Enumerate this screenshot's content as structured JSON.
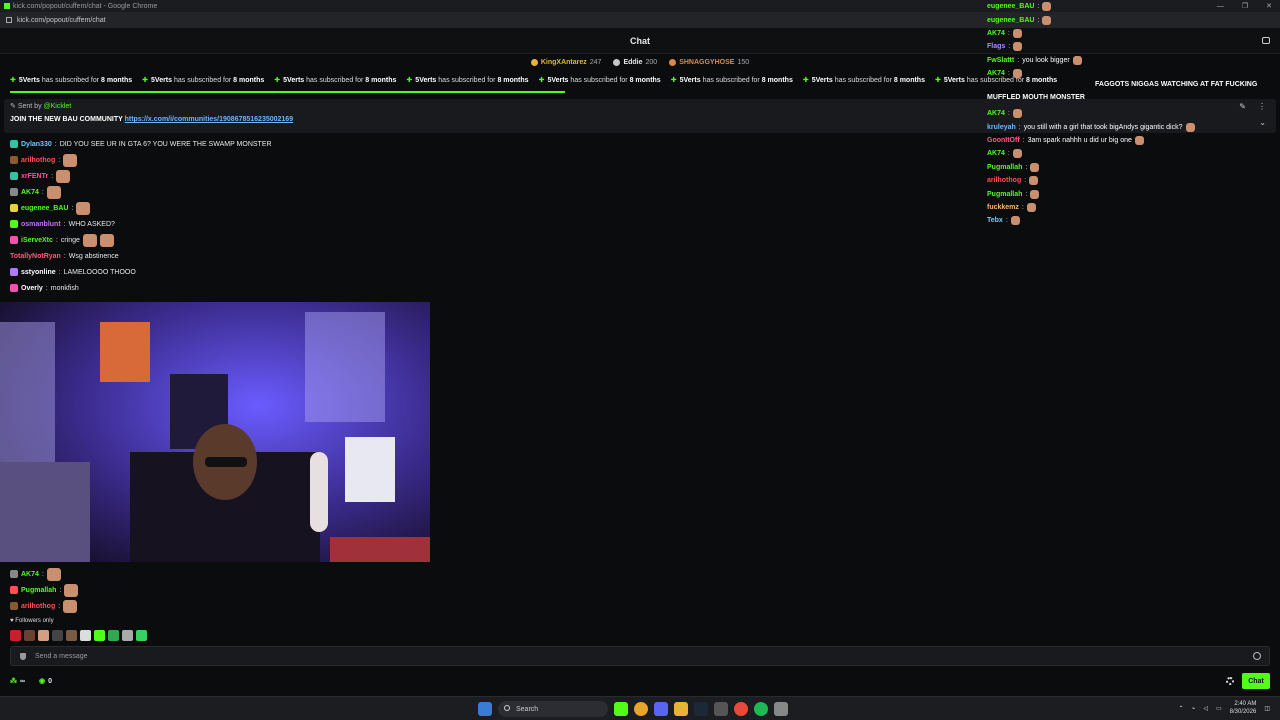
{
  "window": {
    "title": "kick.com/popout/cuffem/chat - Google Chrome",
    "url": "kick.com/popout/cuffem/chat",
    "controls": [
      "—",
      "❐",
      "✕"
    ]
  },
  "header": {
    "title": "Chat"
  },
  "gifters": [
    {
      "name": "KingXAntarez",
      "count": "247",
      "color": "#e8b339"
    },
    {
      "name": "Eddie",
      "count": "200",
      "color": "#ffffff"
    },
    {
      "name": "SHNAGGYHOSE",
      "count": "150",
      "color": "#e08a4a"
    }
  ],
  "ticker": {
    "items": [
      {
        "user": "5Verts",
        "text": "has subscribed for",
        "months": "8 months"
      },
      {
        "user": "5Verts",
        "text": "has subscribed for",
        "months": "8 months"
      },
      {
        "user": "5Verts",
        "text": "has subscribed for",
        "months": "8 months"
      },
      {
        "user": "5Verts",
        "text": "has subscribed for",
        "months": "8 months"
      },
      {
        "user": "5Verts",
        "text": "has subscribed for",
        "months": "8 months"
      },
      {
        "user": "5Verts",
        "text": "has subscribed for",
        "months": "8 months"
      },
      {
        "user": "5Verts",
        "text": "has subscribed for",
        "months": "8 months"
      },
      {
        "user": "5Verts",
        "text": "has subscribed for",
        "months": "8 months"
      }
    ]
  },
  "pinned": {
    "sent_by_label": "Sent by",
    "sender": "@Kicklet",
    "message": "JOIN THE NEW BAU COMMUNITY",
    "link": "https://x.com/i/communities/1908678516235002169"
  },
  "chat": [
    {
      "user": "Dylan330",
      "color": "#6fc7ff",
      "badge": "#33c3a0",
      "text": "DID YOU SEE UR IN GTA 6? YOU WERE THE SWAMP MONSTER",
      "emotes": 0
    },
    {
      "user": "arilhothog",
      "color": "#ff4f4f",
      "badge": "#8a5a2e",
      "text": "",
      "emotes": 1
    },
    {
      "user": "xrFENTr",
      "color": "#ff4f9a",
      "badge": "#33c3a0",
      "text": "",
      "emotes": 1
    },
    {
      "user": "AK74",
      "color": "#53fc18",
      "badge": "#888888",
      "text": "",
      "emotes": 1
    },
    {
      "user": "eugenee_BAU",
      "color": "#53fc18",
      "badge": "#e8d339",
      "text": "",
      "emotes": 1
    },
    {
      "user": "osmanblunt",
      "color": "#c86cff",
      "badge": "#53fc18",
      "text": "WHO ASKED?",
      "emotes": 0
    },
    {
      "user": "iServeXtc",
      "color": "#53fc18",
      "badge": "#ff4fb0",
      "text": "cringe",
      "emotes": 2
    },
    {
      "user": "TotallyNotRyan",
      "color": "#ff5a7a",
      "badge": "",
      "text": "Wsg abstinence",
      "emotes": 0
    },
    {
      "user": "sstyonline",
      "color": "#ffffff",
      "badge": "#b07aff",
      "text": "LAMELOOOO THOOO",
      "emotes": 0
    },
    {
      "user": "Overly",
      "color": "#ffffff",
      "badge": "#ff4fb0",
      "text": "monkfish",
      "emotes": 0
    }
  ],
  "chat_bottom": [
    {
      "user": "AK74",
      "color": "#53fc18",
      "badge": "#888888",
      "text": "",
      "emotes": 1
    },
    {
      "user": "Pugmallah",
      "color": "#53fc18",
      "badge": "#ff4f4f",
      "text": "",
      "emotes": 1
    },
    {
      "user": "arilhothog",
      "color": "#ff4f4f",
      "badge": "#8a5a2e",
      "text": "",
      "emotes": 1
    }
  ],
  "followers_only": "Followers only",
  "input": {
    "placeholder": "Send a message"
  },
  "footer": {
    "infinity": "∞",
    "zero": "0",
    "chat_button": "Chat"
  },
  "overlay_chat": [
    {
      "user": "eugenee_BAU",
      "color": "#53fc18",
      "text": ""
    },
    {
      "user": "eugenee_BAU",
      "color": "#53fc18",
      "text": ""
    },
    {
      "user": "AK74",
      "color": "#53fc18",
      "text": ""
    },
    {
      "user": "Flags",
      "color": "#a98cff",
      "text": ""
    },
    {
      "user": "FwSlattt",
      "color": "#53fc18",
      "text": "you look bigger"
    },
    {
      "user": "AK74",
      "color": "#53fc18",
      "text": ""
    },
    {
      "user": "",
      "color": "#ffffff",
      "text": ""
    },
    {
      "user": "",
      "color": "#ffffff",
      "text": ""
    },
    {
      "user": "AK74",
      "color": "#53fc18",
      "text": ""
    },
    {
      "user": "kruleyah",
      "color": "#6fb6ff",
      "text": "you still with a girl that took bigAndys gigantic dick?"
    },
    {
      "user": "GoonItOff",
      "color": "#ff5a8a",
      "text": "3am spark nahhh u did ur big one"
    },
    {
      "user": "AK74",
      "color": "#53fc18",
      "text": ""
    },
    {
      "user": "Pugmallah",
      "color": "#53fc18",
      "text": ""
    },
    {
      "user": "arilhothog",
      "color": "#ff4f4f",
      "text": ""
    },
    {
      "user": "Pugmallah",
      "color": "#53fc18",
      "text": ""
    },
    {
      "user": "fuckkemz",
      "color": "#ffb36b",
      "text": ""
    },
    {
      "user": "Tebx",
      "color": "#6fd0ff",
      "text": ""
    }
  ],
  "overlay_donation": "FAGGOTS NIGGAS WATCHING AT FAT FUCKING MUFFLED MOUTH MONSTER",
  "taskbar": {
    "search": "Search",
    "time": "2:40 AM",
    "date": "8/30/2026"
  }
}
